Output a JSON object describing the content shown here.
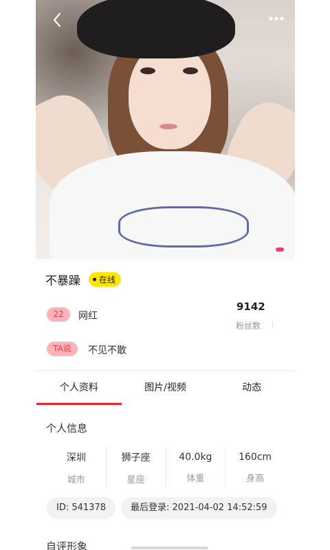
{
  "profile": {
    "name": "不暴躁",
    "status": "在线",
    "age": "22",
    "tag": "网红",
    "fans_count": "9142",
    "fans_label": "粉丝数",
    "ta_label": "TA说",
    "ta_text": "不见不散"
  },
  "tabs": [
    {
      "label": "个人资料",
      "active": true
    },
    {
      "label": "图片/视频",
      "active": false
    },
    {
      "label": "动态",
      "active": false
    }
  ],
  "personal_info": {
    "title": "个人信息",
    "items": [
      {
        "value": "深圳",
        "label": "城市"
      },
      {
        "value": "狮子座",
        "label": "星座"
      },
      {
        "value": "40.0kg",
        "label": "体重"
      },
      {
        "value": "160cm",
        "label": "身高"
      }
    ],
    "id_chip": "ID: 541378",
    "login_chip": "最后登录: 2021-04-02 14:52:59"
  },
  "next_section_title": "自评形象",
  "icons": {
    "back": "chevron-left-icon",
    "more": "more-dots-icon"
  },
  "colors": {
    "accent_red": "#e5232f",
    "pill_bg": "#ffb3b9",
    "pill_text": "#e4404f",
    "online_badge": "#ffe600"
  }
}
